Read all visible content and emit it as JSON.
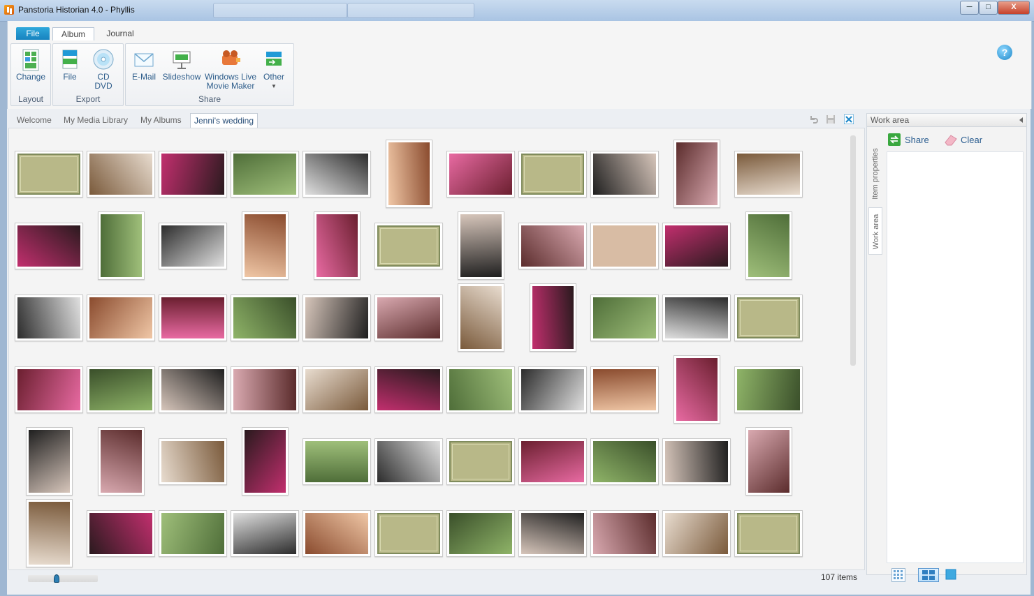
{
  "window": {
    "title": "Panstoria Historian 4.0 - Phyllis",
    "minimize_glyph": "─",
    "maximize_glyph": "□",
    "close_glyph": "X"
  },
  "ribbon": {
    "tabs": [
      {
        "label": "File"
      },
      {
        "label": "Album"
      },
      {
        "label": "Journal"
      }
    ],
    "groups": {
      "layout": {
        "label": "Layout",
        "change_label": "Change"
      },
      "export": {
        "label": "Export",
        "file_label": "File",
        "cd_label": "CD",
        "dvd_label": "DVD"
      },
      "share": {
        "label": "Share",
        "email_label": "E-Mail",
        "slideshow_label": "Slideshow",
        "movie_label_1": "Windows Live",
        "movie_label_2": "Movie Maker",
        "other_label": "Other"
      }
    },
    "help_glyph": "?"
  },
  "doc_tabs": [
    {
      "label": "Welcome"
    },
    {
      "label": "My Media Library"
    },
    {
      "label": "My Albums"
    },
    {
      "label": "Jenni's wedding"
    }
  ],
  "sidebar": {
    "header": "Work area",
    "vertical_tabs": [
      "Item properties",
      "Work area"
    ],
    "share_label": "Share",
    "clear_label": "Clear"
  },
  "status": {
    "item_count": "107 items",
    "zoom_level": 0.4
  },
  "colors": {
    "accent": "#1e88c9",
    "page_tile": "#b8b888",
    "page_border": "#7f8b5c"
  }
}
